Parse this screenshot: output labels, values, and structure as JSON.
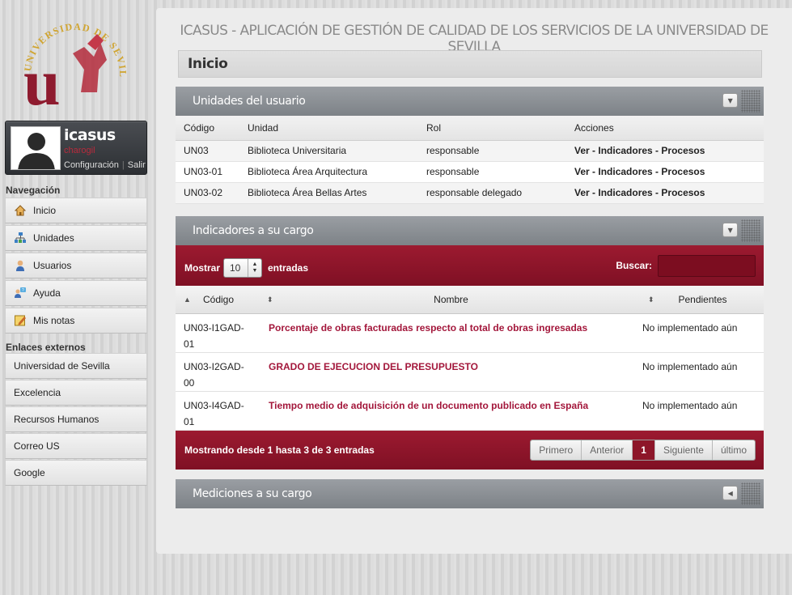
{
  "logo": {
    "text": "UNIVERSIDAD DE SEVILLA"
  },
  "user": {
    "name": "icasus",
    "login": "charogil",
    "config_link": "Configuración",
    "logout_link": "Salir"
  },
  "nav": {
    "heading": "Navegación",
    "items": [
      {
        "label": "Inicio",
        "icon": "home-icon"
      },
      {
        "label": "Unidades",
        "icon": "units-icon"
      },
      {
        "label": "Usuarios",
        "icon": "user-icon"
      },
      {
        "label": "Ayuda",
        "icon": "help-icon"
      },
      {
        "label": "Mis notas",
        "icon": "notes-icon"
      }
    ]
  },
  "external": {
    "heading": "Enlaces externos",
    "items": [
      "Universidad de Sevilla",
      "Excelencia",
      "Recursos Humanos",
      "Correo US",
      "Google"
    ]
  },
  "app_title": "ICASUS - APLICACIÓN DE GESTIÓN DE CALIDAD DE LOS SERVICIOS DE LA UNIVERSIDAD DE SEVILLA",
  "page_title": "Inicio",
  "units": {
    "title": "Unidades del usuario",
    "columns": [
      "Código",
      "Unidad",
      "Rol",
      "Acciones"
    ],
    "rows": [
      {
        "code": "UN03",
        "unit": "Biblioteca Universitaria",
        "role": "responsable"
      },
      {
        "code": "UN03-01",
        "unit": "Biblioteca Área Arquitectura",
        "role": "responsable"
      },
      {
        "code": "UN03-02",
        "unit": "Biblioteca Área Bellas Artes",
        "role": "responsable delegado"
      }
    ],
    "actions": {
      "ver": "Ver",
      "indicadores": "Indicadores",
      "procesos": "Procesos",
      "sep": " - "
    }
  },
  "indicators": {
    "title": "Indicadores a su cargo",
    "show_label": "Mostrar",
    "page_size": "10",
    "entries_label": "entradas",
    "search_label": "Buscar:",
    "columns": [
      "Código",
      "Nombre",
      "Pendientes"
    ],
    "rows": [
      {
        "code_a": "UN03-I1GAD-",
        "code_b": "01",
        "name": "Porcentaje de obras facturadas respecto al total de obras ingresadas",
        "pending": "No implementado aún"
      },
      {
        "code_a": "UN03-I2GAD-",
        "code_b": "00",
        "name": "GRADO DE EJECUCION DEL PRESUPUESTO",
        "pending": "No implementado aún"
      },
      {
        "code_a": "UN03-I4GAD-",
        "code_b": "01",
        "name": "Tiempo medio de adquisición de un documento publicado en España",
        "pending": "No implementado aún"
      }
    ],
    "info": "Mostrando desde 1 hasta 3 de 3 entradas",
    "pager": {
      "first": "Primero",
      "prev": "Anterior",
      "current": "1",
      "next": "Siguiente",
      "last": "último"
    }
  },
  "measurements": {
    "title": "Mediciones a su cargo"
  },
  "colors": {
    "accent": "#9c1a30",
    "link": "#a3173b"
  }
}
